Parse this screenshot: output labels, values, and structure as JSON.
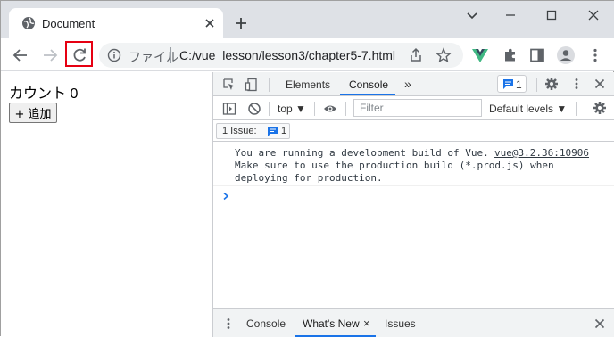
{
  "browser": {
    "tab_title": "Document",
    "omnibox_scheme": "ファイル",
    "url": "C:/vue_lesson/lesson3/chapter5-7.html",
    "highlight_color": "#e60012"
  },
  "page": {
    "count_text": "カウント 0",
    "add_button_label": "+ 追加"
  },
  "devtools": {
    "tabs": [
      "Elements",
      "Console"
    ],
    "active_tab": "Console",
    "more_tabs_glyph": "»",
    "issues_badge_count": "1",
    "context": "top ▼",
    "filter_placeholder": "Filter",
    "levels": "Default levels ▼",
    "issues_chip_label": "1 Issue:",
    "issues_chip_count": "1",
    "console_lines": [
      "You are running a development build of Vue.",
      "Make sure to use the production build (*.prod.js) when",
      "deploying for production."
    ],
    "console_source": "vue@3.2.36:10906",
    "drawer_tabs": [
      "Console",
      "What's New",
      "Issues"
    ],
    "drawer_active": "What's New",
    "drawer_close_glyph": "×"
  }
}
